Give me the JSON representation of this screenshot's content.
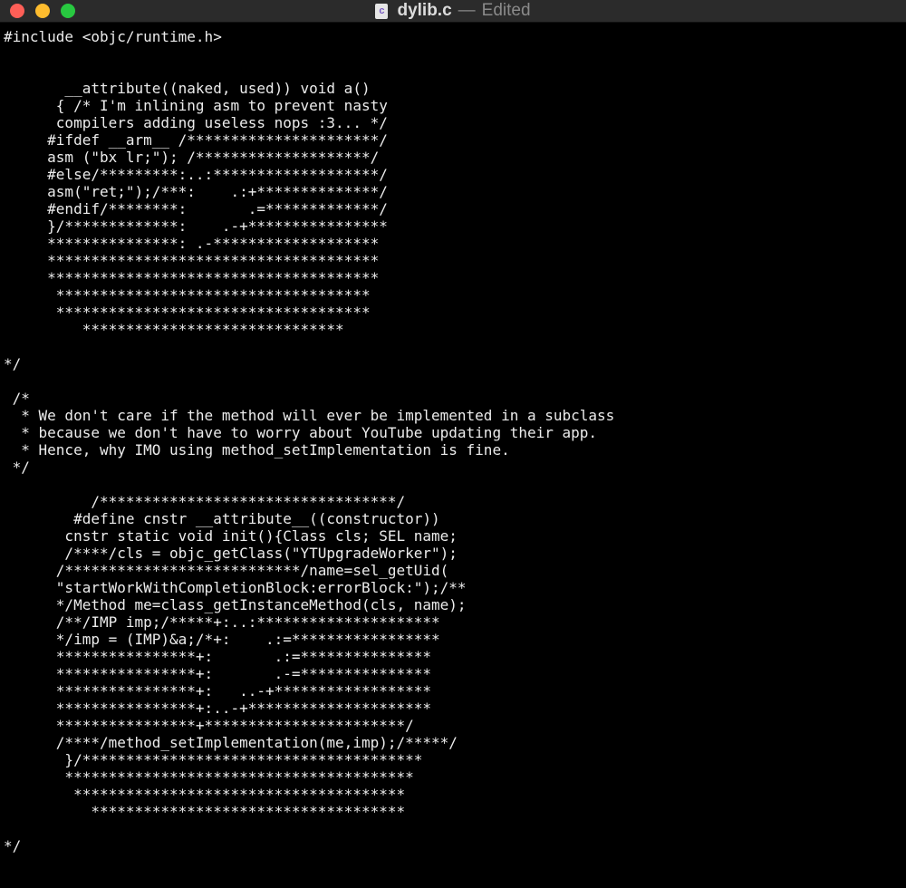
{
  "window": {
    "file_icon_letter": "c",
    "file_name": "dylib.c",
    "separator": "—",
    "status": "Edited"
  },
  "editor": {
    "lines": [
      "#include <objc/runtime.h>",
      "",
      "",
      "       __attribute((naked, used)) void a()",
      "      { /* I'm inlining asm to prevent nasty",
      "      compilers adding useless nops :3... */",
      "     #ifdef __arm__ /**********************/",
      "     asm (\"bx lr;\"); /********************/",
      "     #else/*********:..:*******************/",
      "     asm(\"ret;\");/***:    .:+**************/",
      "     #endif/********:       .=*************/",
      "     }/*************:    .-+****************",
      "     ***************: .-*******************",
      "     **************************************",
      "     **************************************",
      "      ************************************",
      "      ************************************",
      "         ******************************",
      "",
      "*/",
      "",
      " /*",
      "  * We don't care if the method will ever be implemented in a subclass",
      "  * because we don't have to worry about YouTube updating their app.",
      "  * Hence, why IMO using method_setImplementation is fine.",
      " */",
      "",
      "          /**********************************/",
      "        #define cnstr __attribute__((constructor))",
      "       cnstr static void init(){Class cls; SEL name;",
      "       /****/cls = objc_getClass(\"YTUpgradeWorker\");",
      "      /***************************/name=sel_getUid(",
      "      \"startWorkWithCompletionBlock:errorBlock:\");/**",
      "      */Method me=class_getInstanceMethod(cls, name);",
      "      /**/IMP imp;/*****+:..:*********************",
      "      */imp = (IMP)&a;/*+:    .:=*****************",
      "      ****************+:       .:=***************",
      "      ****************+:       .-=***************",
      "      ****************+:   ..-+******************",
      "      ****************+:..-+*********************",
      "      ****************+***********************/",
      "      /****/method_setImplementation(me,imp);/*****/",
      "       }/***************************************",
      "       ****************************************",
      "        **************************************",
      "          ************************************",
      "",
      "*/"
    ]
  }
}
